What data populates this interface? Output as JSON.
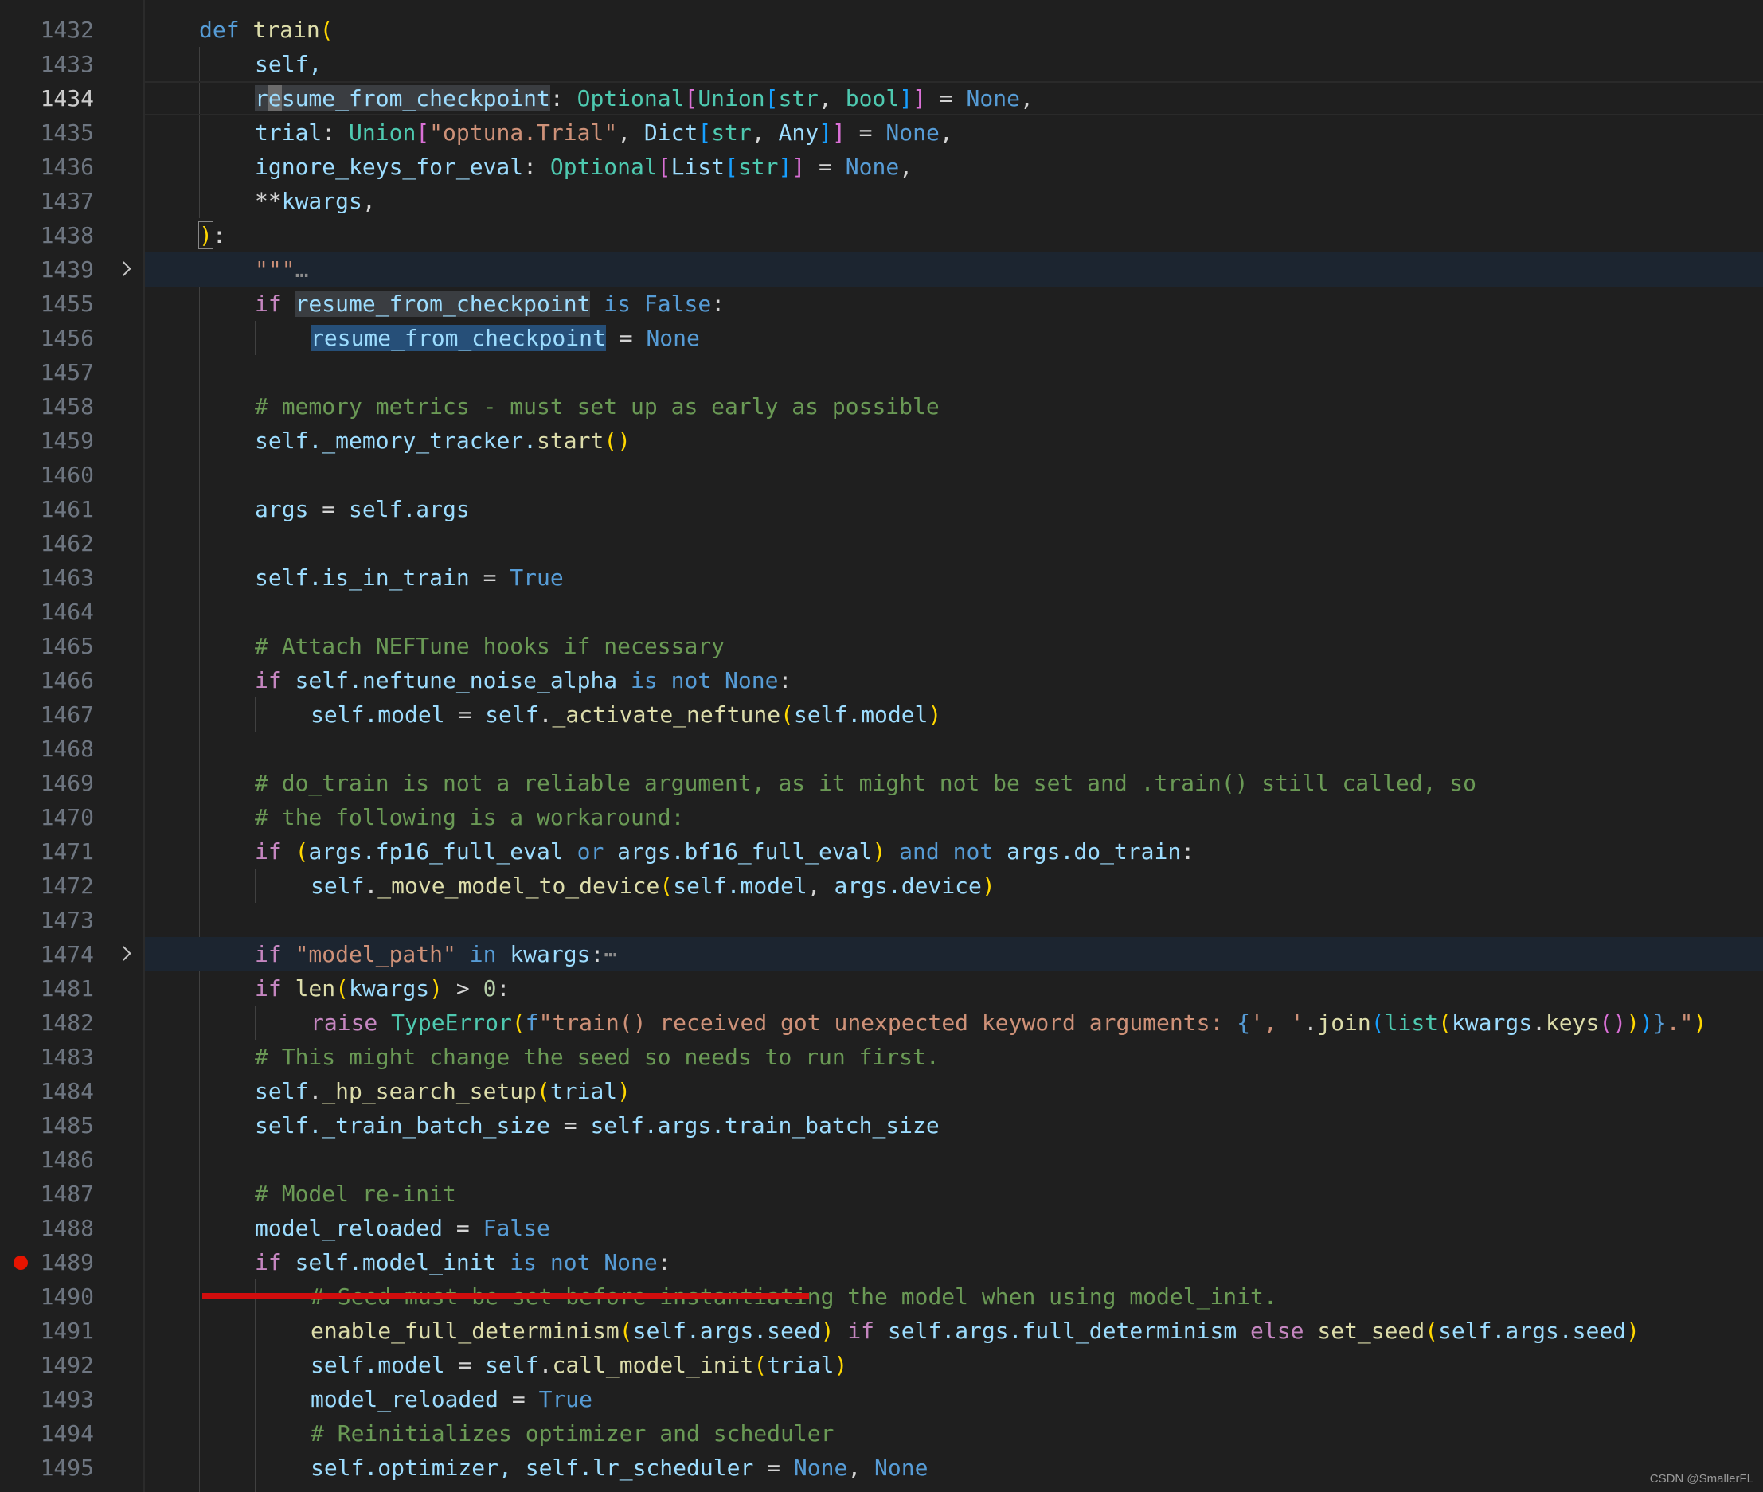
{
  "gutter": {
    "line_numbers": [
      "1432",
      "1433",
      "1434",
      "1435",
      "1436",
      "1437",
      "1438",
      "1439",
      "1455",
      "1456",
      "1457",
      "1458",
      "1459",
      "1460",
      "1461",
      "1462",
      "1463",
      "1464",
      "1465",
      "1466",
      "1467",
      "1468",
      "1469",
      "1470",
      "1471",
      "1472",
      "1473",
      "1474",
      "1481",
      "1482",
      "1483",
      "1484",
      "1485",
      "1486",
      "1487",
      "1488",
      "1489",
      "1490",
      "1491",
      "1492",
      "1493",
      "1494",
      "1495"
    ],
    "current_line": "1434",
    "breakpoint_line": "1489",
    "folded_lines": [
      "1439",
      "1474"
    ]
  },
  "code": {
    "l1432": {
      "def": "def",
      "name": "train",
      "open": "("
    },
    "l1433": {
      "text": "self,"
    },
    "l1434": {
      "cursor_pre": "r",
      "cursor_char": "e",
      "rest": "sume_from_checkpoint",
      "colon": ": ",
      "opt": "Optional",
      "o1": "[",
      "union": "Union",
      "o2": "[",
      "t1": "str",
      "comma": ", ",
      "t2": "bool",
      "c2": "]",
      "c1": "]",
      "eq": " = ",
      "none": "None",
      "end": ","
    },
    "l1435": {
      "name": "trial",
      "colon": ": ",
      "union": "Union",
      "o1": "[",
      "s": "\"optuna.Trial\"",
      "comma": ", ",
      "dict": "Dict",
      "o2": "[",
      "t1": "str",
      "comma2": ", ",
      "t2": "Any",
      "c2": "]",
      "c1": "]",
      "eq": " = ",
      "none": "None",
      "end": ","
    },
    "l1436": {
      "name": "ignore_keys_for_eval",
      "colon": ": ",
      "opt": "Optional",
      "o1": "[",
      "list": "List",
      "o2": "[",
      "t1": "str",
      "c2": "]",
      "c1": "]",
      "eq": " = ",
      "none": "None",
      "end": ","
    },
    "l1437": {
      "star": "**",
      "name": "kwargs",
      "end": ","
    },
    "l1438": {
      "close": ")",
      "colon": ":"
    },
    "l1439": {
      "doc": "\"\"\"",
      "ellipsis": "…"
    },
    "l1455": {
      "if": "if",
      "var": "resume_from_checkpoint",
      "is": " is ",
      "false": "False",
      "colon": ":"
    },
    "l1456": {
      "var": "resume_from_checkpoint",
      "eq": " = ",
      "none": "None"
    },
    "l1458": {
      "text": "# memory metrics - must set up as early as possible"
    },
    "l1459": {
      "self": "self",
      "attr": "._memory_tracker.",
      "fn": "start",
      "p": "()"
    },
    "l1461": {
      "var": "args",
      "eq": " = ",
      "self": "self",
      "attr": ".args"
    },
    "l1463": {
      "self": "self",
      "attr": ".is_in_train",
      "eq": " = ",
      "true": "True"
    },
    "l1465": {
      "text": "# Attach NEFTune hooks if necessary"
    },
    "l1466": {
      "if": "if",
      "self": " self",
      "attr": ".neftune_noise_alpha",
      "is": " is ",
      "not": "not ",
      "none": "None",
      "colon": ":"
    },
    "l1467": {
      "self": "self",
      "attr": ".model",
      "eq": " = ",
      "self2": "self",
      "dot": ".",
      "fn": "_activate_neftune",
      "o": "(",
      "arg": "self.model",
      "c": ")"
    },
    "l1469": {
      "text": "# do_train is not a reliable argument, as it might not be set and .train() still called, so"
    },
    "l1470": {
      "text": "# the following is a workaround:"
    },
    "l1471": {
      "if": "if",
      "o": " (",
      "a1": "args.fp16_full_eval",
      "or": " or ",
      "a2": "args.bf16_full_eval",
      "c": ")",
      "and": " and ",
      "not": "not ",
      "a3": "args.do_train",
      "colon": ":"
    },
    "l1472": {
      "self": "self",
      "dot": ".",
      "fn": "_move_model_to_device",
      "o": "(",
      "a1": "self.model",
      "comma": ", ",
      "a2": "args.device",
      "c": ")"
    },
    "l1474": {
      "if": "if",
      "s": " \"model_path\"",
      "in": " in ",
      "var": "kwargs",
      "colon": ":",
      "ellipsis": "⋯"
    },
    "l1481": {
      "if": "if",
      "fn": " len",
      "o": "(",
      "var": "kwargs",
      "c": ")",
      "gt": " > ",
      "num": "0",
      "colon": ":"
    },
    "l1482": {
      "raise": "raise",
      "type": " TypeError",
      "o": "(",
      "f": "f",
      "s1": "\"train() received got unexpected keyword arguments: ",
      "b": "{",
      "s2": "', '",
      "dot": ".",
      "join": "join",
      "o2": "(",
      "list": "list",
      "o3": "(",
      "kw": "kwargs",
      "dot2": ".",
      "keys": "keys",
      "o4": "()",
      "c3": ")",
      "c2": ")",
      "b2": "}",
      "s3": ".\"",
      "c": ")"
    },
    "l1483": {
      "text": "# This might change the seed so needs to run first."
    },
    "l1484": {
      "self": "self",
      "dot": ".",
      "fn": "_hp_search_setup",
      "o": "(",
      "arg": "trial",
      "c": ")"
    },
    "l1485": {
      "self": "self",
      "attr": "._train_batch_size",
      "eq": " = ",
      "rhs": "self.args.train_batch_size"
    },
    "l1487": {
      "text": "# Model re-init"
    },
    "l1488": {
      "var": "model_reloaded",
      "eq": " = ",
      "false": "False"
    },
    "l1489": {
      "if": "if",
      "self": " self",
      "attr": ".model_init",
      "is": " is ",
      "not": "not ",
      "none": "None",
      "colon": ":"
    },
    "l1490": {
      "text": "# Seed must be set before instantiating the model when using model_init."
    },
    "l1491": {
      "fn": "enable_full_determinism",
      "o": "(",
      "a": "self.args.seed",
      "c": ")",
      "if": " if ",
      "cond": "self.args.full_determinism",
      "else": " else ",
      "fn2": "set_seed",
      "o2": "(",
      "a2": "self.args.seed",
      "c2": ")"
    },
    "l1492": {
      "self": "self",
      "attr": ".model",
      "eq": " = ",
      "self2": "self",
      "dot": ".",
      "fn": "call_model_init",
      "o": "(",
      "arg": "trial",
      "c": ")"
    },
    "l1493": {
      "var": "model_reloaded",
      "eq": " = ",
      "true": "True"
    },
    "l1494": {
      "text": "# Reinitializes optimizer and scheduler"
    },
    "l1495": {
      "lhs": "self.optimizer, self.lr_scheduler",
      "eq": " = ",
      "n1": "None",
      "comma": ", ",
      "n2": "None"
    }
  },
  "watermark": "CSDN @SmallerFL",
  "colors": {
    "background": "#1f1f1f",
    "keyword": "#569cd6",
    "control": "#c586c0",
    "function": "#dcdcaa",
    "variable": "#9cdcfe",
    "type": "#4ec9b0",
    "string": "#ce9178",
    "comment": "#6a9955",
    "breakpoint": "#e51400",
    "annotation_underline": "#d10d0d"
  }
}
